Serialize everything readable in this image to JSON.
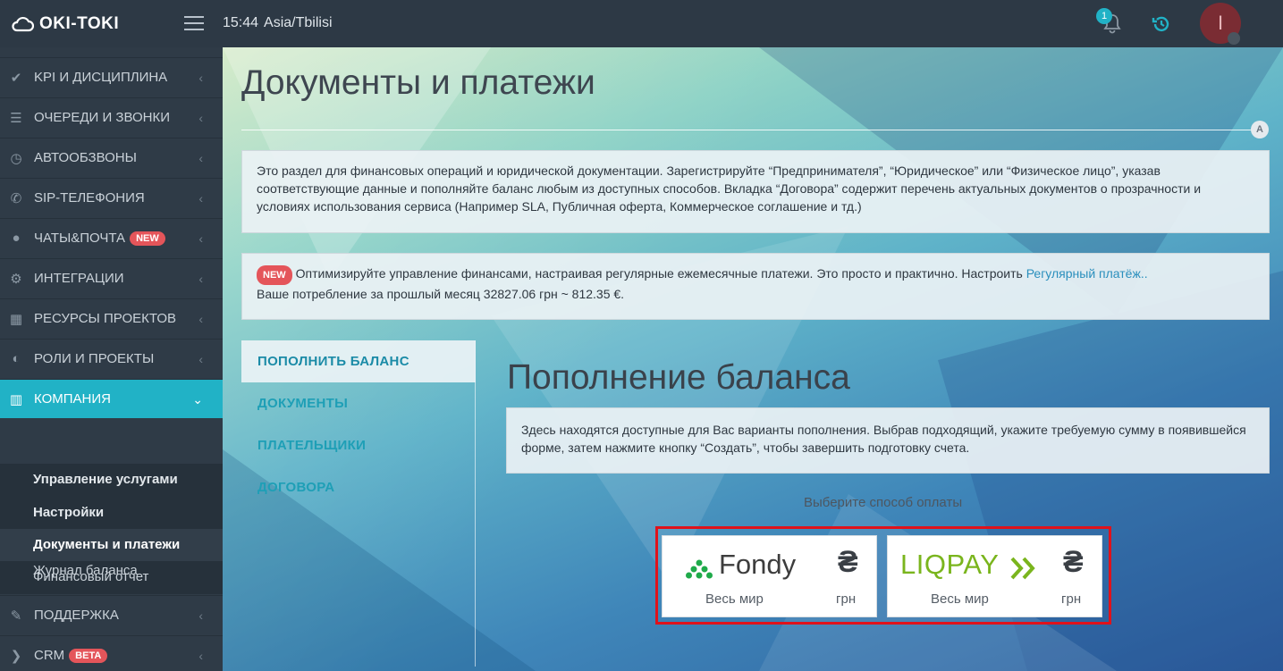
{
  "topbar": {
    "brand": "OKI-TOKI",
    "time": "15:44",
    "timezone": "Asia/Tbilisi",
    "notifications_count": "1",
    "avatar_initial": "I"
  },
  "sidebar": {
    "items": [
      {
        "label": "KPI И ДИСЦИПЛИНА",
        "icon": "check-icon"
      },
      {
        "label": "ОЧЕРЕДИ И ЗВОНКИ",
        "icon": "list-icon"
      },
      {
        "label": "АВТООБЗВОНЫ",
        "icon": "clock-icon"
      },
      {
        "label": "SIP-ТЕЛЕФОНИЯ",
        "icon": "phone-icon"
      },
      {
        "label": "ЧАТЫ&ПОЧТА",
        "icon": "chat-icon",
        "badge": "NEW"
      },
      {
        "label": "ИНТЕГРАЦИИ",
        "icon": "gears-icon"
      },
      {
        "label": "РЕСУРСЫ ПРОЕКТОВ",
        "icon": "grid-icon"
      },
      {
        "label": "РОЛИ И ПРОЕКТЫ",
        "icon": "toggle-icon"
      },
      {
        "label": "КОМПАНИЯ",
        "icon": "bar-chart-icon"
      },
      {
        "label": "ПОДДЕРЖКА",
        "icon": "wrench-icon"
      },
      {
        "label": "CRM",
        "icon": "chevron-icon",
        "badge": "BETA"
      }
    ],
    "submenu": [
      "Управление услугами",
      "Настройки",
      "Документы и платежи",
      "Финансовый отчет",
      "Журнал баланса"
    ]
  },
  "main": {
    "title": "Документы и платежи",
    "corner_letter": "A",
    "intro": "Это раздел для финансовых операций и юридической документации. Зарегистрируйте “Предпринимателя”, “Юридическое” или “Физическое лицо”, указав соответствующие данные и пополняйте баланс любым из доступных способов. Вкладка “Договора” содержит перечень актуальных документов о прозрачности и условиях использования сервиса (Например SLA, Публичная оферта, Коммерческое соглашение и тд.)",
    "notice": {
      "badge": "NEW",
      "text": "Оптимизируйте управление финансами, настраивая регулярные ежемесячные платежи. Это просто и практично. Настроить",
      "link": "Регулярный платёж..",
      "consumption": "Ваше потребление за прошлый месяц 32827.06 грн ~ 812.35 €."
    },
    "tabs": [
      "ПОПОЛНИТЬ БАЛАНС",
      "ДОКУМЕНТЫ",
      "ПЛАТЕЛЬЩИКИ",
      "ДОГОВОРА"
    ],
    "section_title": "Пополнение баланса",
    "section_info": "Здесь находятся доступные для Вас варианты пополнения. Выбрав подходящий, укажите требуемую сумму в появившейся форме, затем нажмите кнопку “Создать”, чтобы завершить подготовку счета.",
    "choose_label": "Выберите способ оплаты",
    "payments": [
      {
        "name": "Fondy",
        "region": "Весь мир",
        "currency_symbol": "₴",
        "currency": "грн",
        "color": "#3d3d3d",
        "accent": "#1faa4a"
      },
      {
        "name": "LIQPAY",
        "region": "Весь мир",
        "currency_symbol": "₴",
        "currency": "грн",
        "color": "#7ab51d",
        "accent": "#7ab51d"
      }
    ]
  }
}
